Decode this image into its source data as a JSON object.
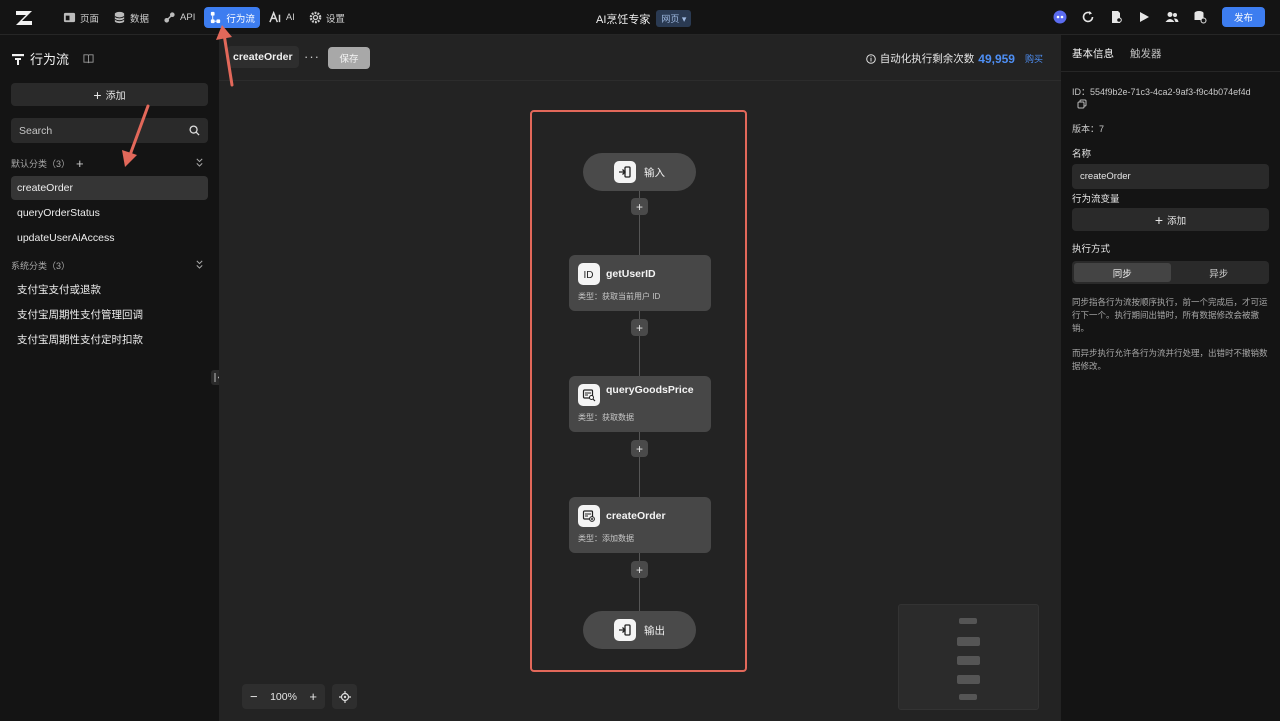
{
  "topbar": {
    "nav": [
      {
        "label": "页面",
        "icon": "pages-icon"
      },
      {
        "label": "数据",
        "icon": "database-icon"
      },
      {
        "label": "API",
        "icon": "api-icon"
      },
      {
        "label": "行为流",
        "icon": "flow-icon",
        "active": true
      },
      {
        "label": "AI",
        "icon": "ai-icon"
      },
      {
        "label": "设置",
        "icon": "gear-icon"
      }
    ],
    "app_title": "AI烹饪专家",
    "app_badge": "网页 ▾",
    "publish_label": "发布"
  },
  "left": {
    "title": "行为流",
    "add_label": "添加",
    "search_placeholder": "Search",
    "groups": [
      {
        "label": "默认分类（3）",
        "items": [
          "createOrder",
          "queryOrderStatus",
          "updateUserAiAccess"
        ]
      },
      {
        "label": "系统分类（3）",
        "items": [
          "支付宝支付或退款",
          "支付宝周期性支付管理回调",
          "支付宝周期性支付定时扣款"
        ]
      }
    ]
  },
  "canvas": {
    "flow_name": "createOrder",
    "more_label": "···",
    "save_label": "保存",
    "exec_label": "自动化执行剩余次数",
    "exec_count": "49,959",
    "buy_label": "购买",
    "start_label": "输入",
    "end_label": "输出",
    "nodes": [
      {
        "name": "getUserID",
        "type": "类型：获取当前用户 ID",
        "icon": "id-icon"
      },
      {
        "name": "queryGoodsPrice",
        "type": "类型：获取数据",
        "icon": "query-data-icon"
      },
      {
        "name": "createOrder",
        "type": "类型：添加数据",
        "icon": "add-data-icon"
      }
    ],
    "zoom": "100%",
    "zoom_minus": "−",
    "zoom_plus": "+"
  },
  "right": {
    "tabs": [
      "基本信息",
      "触发器"
    ],
    "id_text": "ID：554f9b2e-71c3-4ca2-9af3-f9c4b074ef4d",
    "version_text": "版本：7",
    "name_label": "名称",
    "name_value": "createOrder",
    "vars_label": "行为流变量",
    "vars_add": "添加",
    "exec_mode_label": "执行方式",
    "mode_sync": "同步",
    "mode_async": "异步",
    "desc1": "同步指各行为流按顺序执行，前一个完成后，才可运行下一个。执行期间出错时，所有数据修改会被撤销。",
    "desc2": "而异步执行允许各行为流并行处理，出错时不撤销数据修改。"
  },
  "colors": {
    "accent": "#3d7df0",
    "highlight_frame": "#e2685a",
    "annotation_arrow": "#e2685a"
  }
}
